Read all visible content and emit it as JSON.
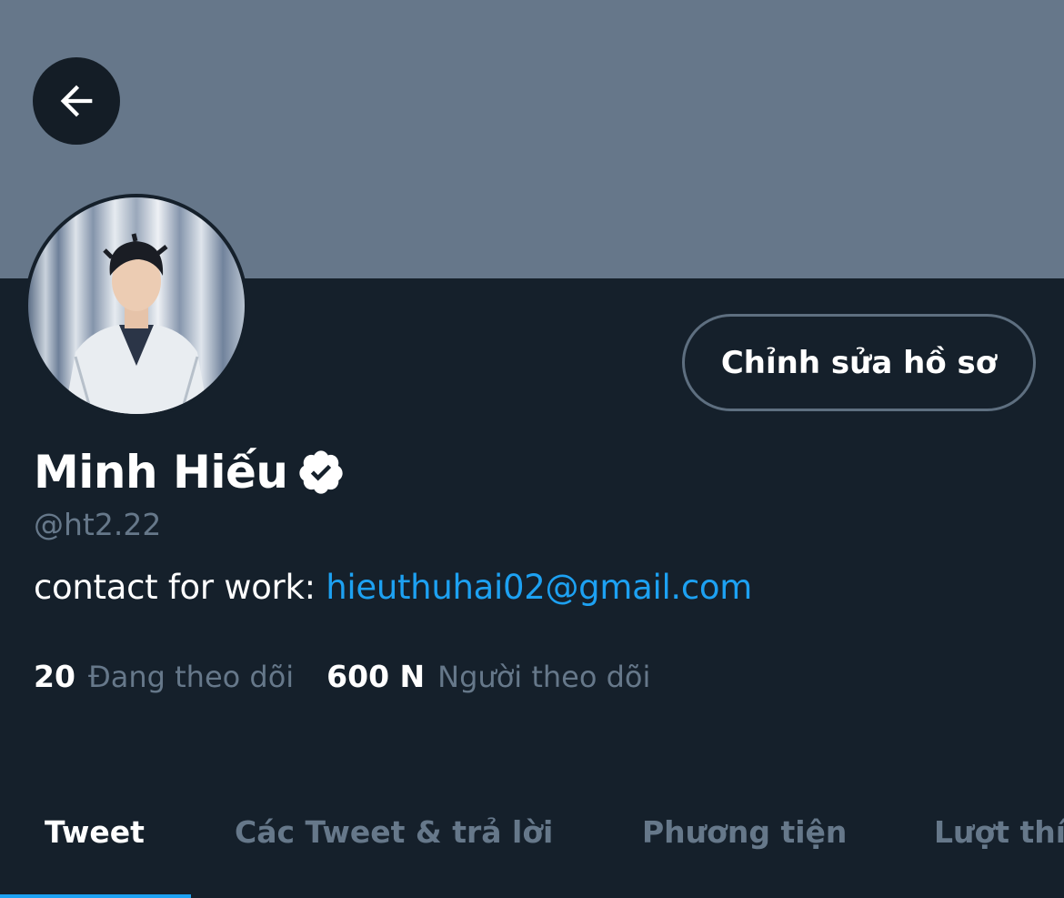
{
  "profile": {
    "name": "Minh Hiếu",
    "handle": "@ht2.22",
    "verified": true,
    "bio_prefix": "contact for work: ",
    "bio_link": "hieuthuhai02@gmail.com",
    "edit_button": "Chỉnh sửa hồ sơ"
  },
  "stats": {
    "following_count": "20",
    "following_label": "Đang theo dõi",
    "followers_count": "600 N",
    "followers_label": "Người theo dõi"
  },
  "tabs": [
    {
      "label": "Tweet",
      "active": true
    },
    {
      "label": "Các Tweet & trả lời",
      "active": false
    },
    {
      "label": "Phương tiện",
      "active": false
    },
    {
      "label": "Lượt thích",
      "active": false
    }
  ],
  "colors": {
    "background": "#15202b",
    "banner": "#66778a",
    "accent": "#1da1f2",
    "muted_text": "#66788a"
  },
  "icons": {
    "back": "arrow-left-icon",
    "verified": "verified-badge-icon"
  }
}
